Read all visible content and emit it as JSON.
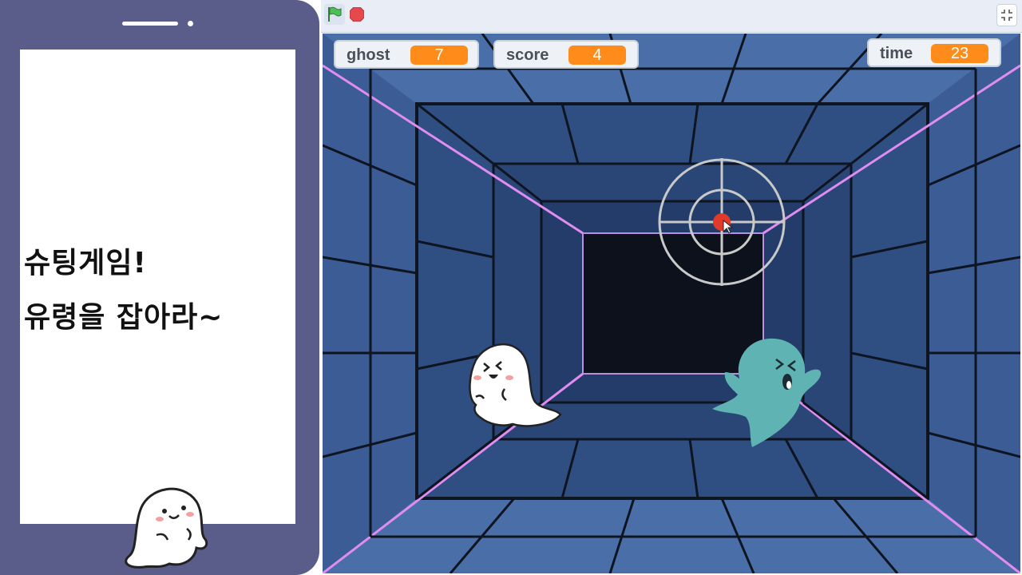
{
  "phone": {
    "caption_line1": "슈팅게임!",
    "caption_line2": "유령을 잡아라~"
  },
  "toolbar": {
    "green_flag_icon": "green-flag-icon",
    "stop_icon": "stop-sign-icon",
    "fullscreen_icon": "exit-fullscreen-icon"
  },
  "monitors": {
    "ghost": {
      "label": "ghost",
      "value": "7"
    },
    "score": {
      "label": "score",
      "value": "4"
    },
    "time": {
      "label": "time",
      "value": "23"
    }
  },
  "colors": {
    "phone": "#5a5c8a",
    "tunnel": "#3a5d93",
    "monitor_value": "#ff8c1a",
    "ghost_teal": "#5fb3b3",
    "neon": "#e08cf0"
  }
}
